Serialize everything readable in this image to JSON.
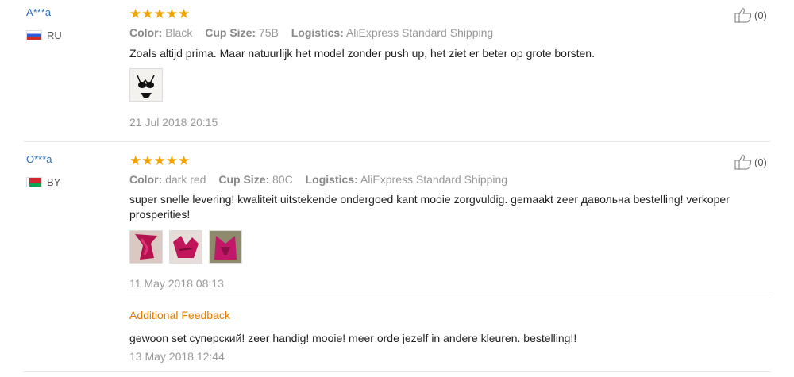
{
  "reviews": [
    {
      "user": "A***a",
      "country": "RU",
      "stars": "★★★★★",
      "color_label": "Color:",
      "color": "Black",
      "cup_label": "Cup Size:",
      "cup": "75B",
      "logistics_label": "Logistics:",
      "logistics": "AliExpress Standard Shipping",
      "text": "Zoals altijd prima. Maar natuurlijk het model zonder push up, het ziet er beter op grote borsten.",
      "date": "21 Jul 2018 20:15",
      "helpful": "(0)"
    },
    {
      "user": "O***a",
      "country": "BY",
      "stars": "★★★★★",
      "color_label": "Color:",
      "color": "dark red",
      "cup_label": "Cup Size:",
      "cup": "80C",
      "logistics_label": "Logistics:",
      "logistics": "AliExpress Standard Shipping",
      "text": "super snelle levering! kwaliteit uitstekende ondergoed kant mooie zorgvuldig. gemaakt zeer давольна bestelling! verkoper prosperities!",
      "date": "11 May 2018 08:13",
      "helpful": "(0)",
      "additional": {
        "title": "Additional Feedback",
        "text": "gewoon set суперский! zeer handig! mooie! meer orde jezelf in andere kleuren. bestelling!!",
        "date": "13 May 2018 12:44"
      }
    }
  ],
  "colors": {
    "star": "#f1a300",
    "username": "#2a6cbf",
    "additional": "#e27b00"
  },
  "icons": {
    "helpful": "thumbs-up-icon"
  }
}
